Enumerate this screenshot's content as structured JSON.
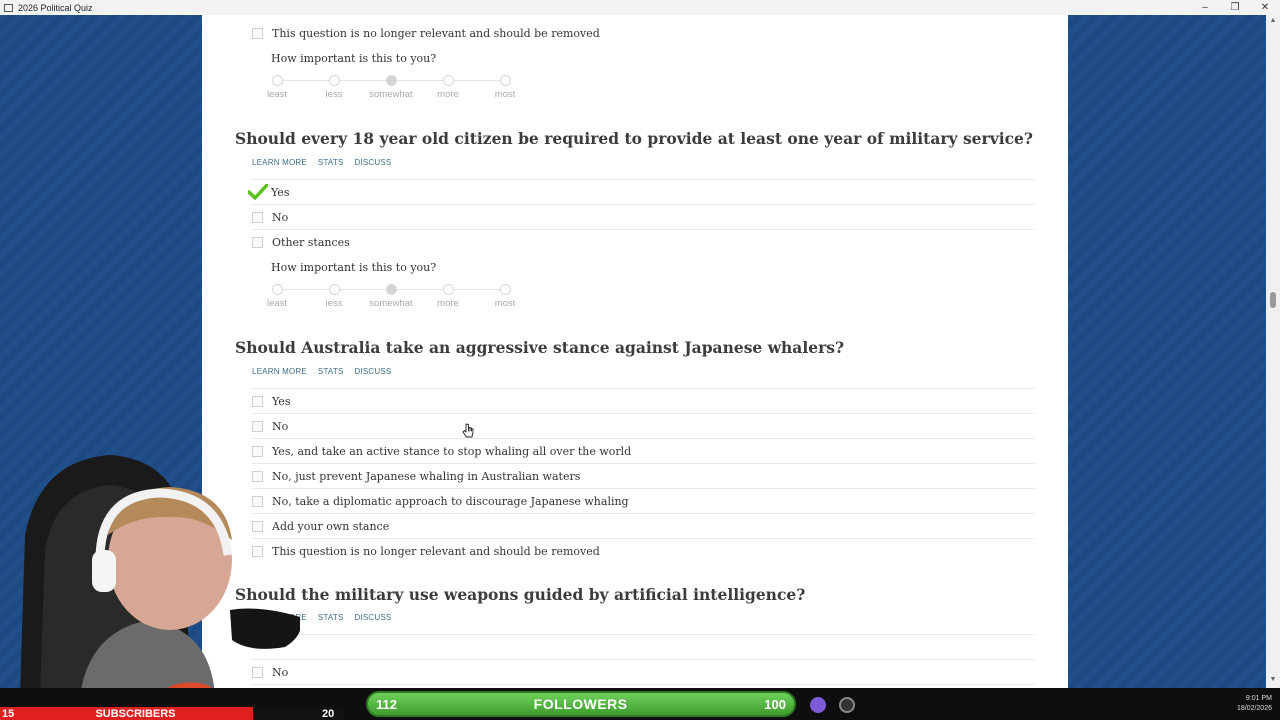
{
  "window": {
    "title": "2026 Political Quiz",
    "controls": [
      "–",
      "❐",
      "✕"
    ]
  },
  "importance": {
    "prompt": "How important is this to you?",
    "levels": [
      "least",
      "less",
      "somewhat",
      "more",
      "most"
    ],
    "selected": "somewhat"
  },
  "links": {
    "learn_more": "LEARN MORE",
    "stats": "STATS",
    "discuss": "DISCUSS"
  },
  "prev_question": {
    "last_option": "This question is no longer relevant and should be removed"
  },
  "q1": {
    "title": "Should every 18 year old citizen be required to provide at least one year of military service?",
    "options": [
      "Yes",
      "No",
      "Other stances"
    ],
    "checked": "Yes"
  },
  "q2": {
    "title": "Should Australia take an aggressive stance against Japanese whalers?",
    "options": [
      "Yes",
      "No",
      "Yes, and take an active stance to stop whaling all over the world",
      "No, just prevent Japanese whaling in Australian waters",
      "No, take a diplomatic approach to discourage Japanese whaling",
      "Add your own stance",
      "This question is no longer relevant and should be removed"
    ]
  },
  "q3": {
    "title": "Should the military use weapons guided by artificial intelligence?",
    "options": [
      "No"
    ]
  },
  "stream": {
    "subscribers_label": "SUBSCRIBERS",
    "subscribers_left": "15",
    "subscribers_right": "20",
    "followers_label": "FOLLOWERS",
    "followers_left": "112",
    "followers_right": "100"
  },
  "taskbar": {
    "time": "9:01 PM",
    "date": "18/02/2026"
  },
  "colors": {
    "background_blue": "#1f4d86",
    "link": "#3d6f8c",
    "check_green": "#5bbf1e",
    "followers_green": "#4fb23b",
    "subscribers_red": "#e01f1f"
  }
}
